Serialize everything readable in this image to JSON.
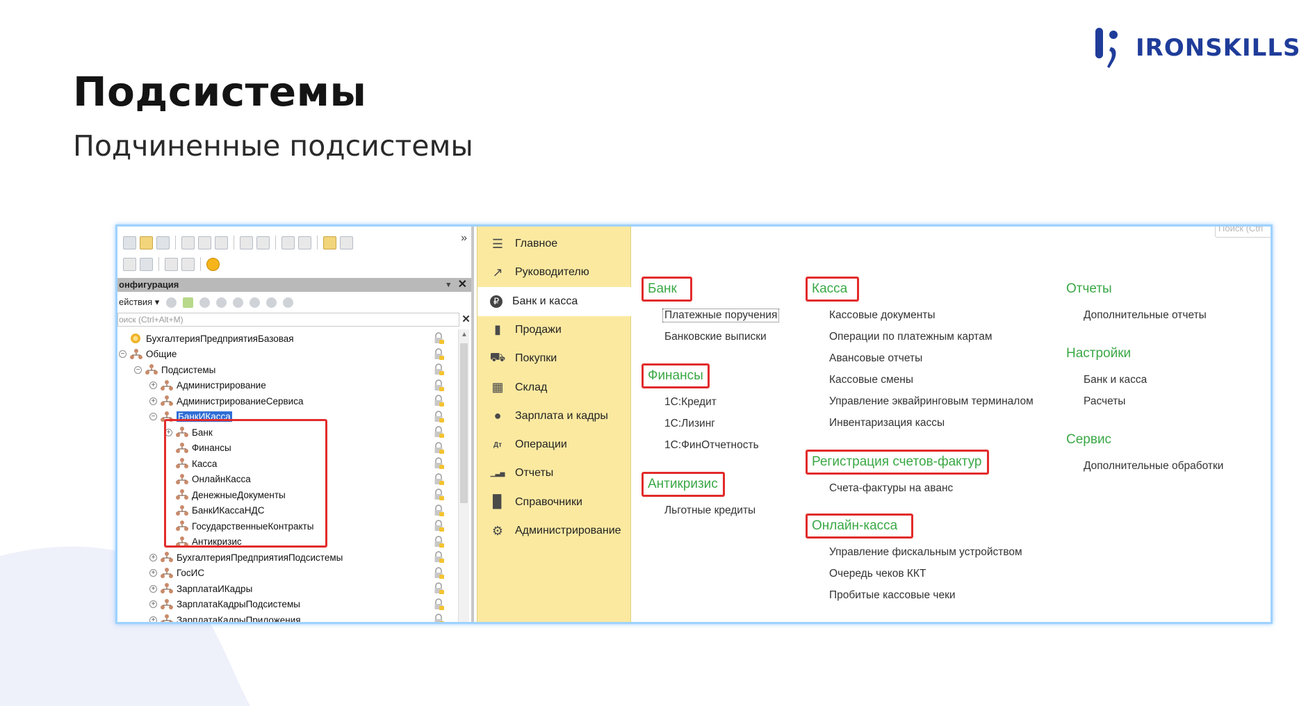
{
  "slide": {
    "title": "Подсистемы",
    "subtitle": "Подчиненные подсистемы",
    "logo_text": "IRONSKILLS",
    "colors": {
      "brand": "#1f3c9a",
      "accent_green": "#3aa845",
      "highlight_red": "#e22b2b",
      "panel_yellow": "#fbe9a0"
    }
  },
  "configurator": {
    "panel_title": "онфигурация",
    "actions_label": "ействия ▾",
    "search_placeholder": "оиск (Ctrl+Alt+M)",
    "close_icon": "close-icon",
    "tree": [
      {
        "label": "БухгалтерияПредприятияБазовая",
        "expander": ""
      },
      {
        "label": "Общие",
        "expander": "⊖"
      },
      {
        "label": "Подсистемы",
        "expander": "⊖"
      },
      {
        "label": "Администрирование",
        "expander": "⊕"
      },
      {
        "label": "АдминистрированиеСервиса",
        "expander": "⊕"
      },
      {
        "label": "БанкИКасса",
        "expander": "⊖",
        "selected": true
      },
      {
        "label": "Банк",
        "expander": "⊕"
      },
      {
        "label": "Финансы",
        "expander": ""
      },
      {
        "label": "Касса",
        "expander": ""
      },
      {
        "label": "ОнлайнКасса",
        "expander": ""
      },
      {
        "label": "ДенежныеДокументы",
        "expander": ""
      },
      {
        "label": "БанкИКассаНДС",
        "expander": ""
      },
      {
        "label": "ГосударственныеКонтракты",
        "expander": ""
      },
      {
        "label": "Антикризис",
        "expander": ""
      },
      {
        "label": "БухгалтерияПредприятияПодсистемы",
        "expander": "⊕"
      },
      {
        "label": "ГосИС",
        "expander": "⊕"
      },
      {
        "label": "ЗарплатаИКадры",
        "expander": "⊕"
      },
      {
        "label": "ЗарплатаКадрыПодсистемы",
        "expander": "⊕"
      },
      {
        "label": "ЗарплатаКадрыПриложения",
        "expander": "⊕"
      }
    ]
  },
  "sections": [
    {
      "label": "Главное",
      "icon": "menu-icon"
    },
    {
      "label": "Руководителю",
      "icon": "trend-icon"
    },
    {
      "label": "Банк и касса",
      "icon": "ruble-icon",
      "active": true
    },
    {
      "label": "Продажи",
      "icon": "bag-icon"
    },
    {
      "label": "Покупки",
      "icon": "cart-icon"
    },
    {
      "label": "Склад",
      "icon": "grid-icon"
    },
    {
      "label": "Зарплата и кадры",
      "icon": "person-icon"
    },
    {
      "label": "Операции",
      "icon": "debit-credit-icon"
    },
    {
      "label": "Отчеты",
      "icon": "bar-chart-icon"
    },
    {
      "label": "Справочники",
      "icon": "book-icon"
    },
    {
      "label": "Администрирование",
      "icon": "gear-icon"
    }
  ],
  "content": {
    "search_placeholder": "Поиск (Ctrl",
    "groups": {
      "bank": {
        "title": "Банк",
        "items": [
          "Платежные поручения",
          "Банковские выписки"
        ]
      },
      "finance": {
        "title": "Финансы",
        "items": [
          "1С:Кредит",
          "1С:Лизинг",
          "1С:ФинОтчетность"
        ]
      },
      "anticrisis": {
        "title": "Антикризис",
        "items": [
          "Льготные кредиты"
        ]
      },
      "cash": {
        "title": "Касса",
        "items": [
          "Кассовые документы",
          "Операции по платежным картам",
          "Авансовые отчеты",
          "Кассовые смены",
          "Управление эквайринговым терминалом",
          "Инвентаризация кассы"
        ]
      },
      "invoices": {
        "title": "Регистрация счетов-фактур",
        "items": [
          "Счета-фактуры на аванс"
        ]
      },
      "online_cash": {
        "title": "Онлайн-касса",
        "items": [
          "Управление фискальным устройством",
          "Очередь чеков ККТ",
          "Пробитые кассовые чеки"
        ]
      },
      "reports": {
        "title": "Отчеты",
        "items": [
          "Дополнительные отчеты"
        ]
      },
      "settings": {
        "title": "Настройки",
        "items": [
          "Банк и касса",
          "Расчеты"
        ]
      },
      "service": {
        "title": "Сервис",
        "items": [
          "Дополнительные обработки"
        ]
      }
    }
  }
}
